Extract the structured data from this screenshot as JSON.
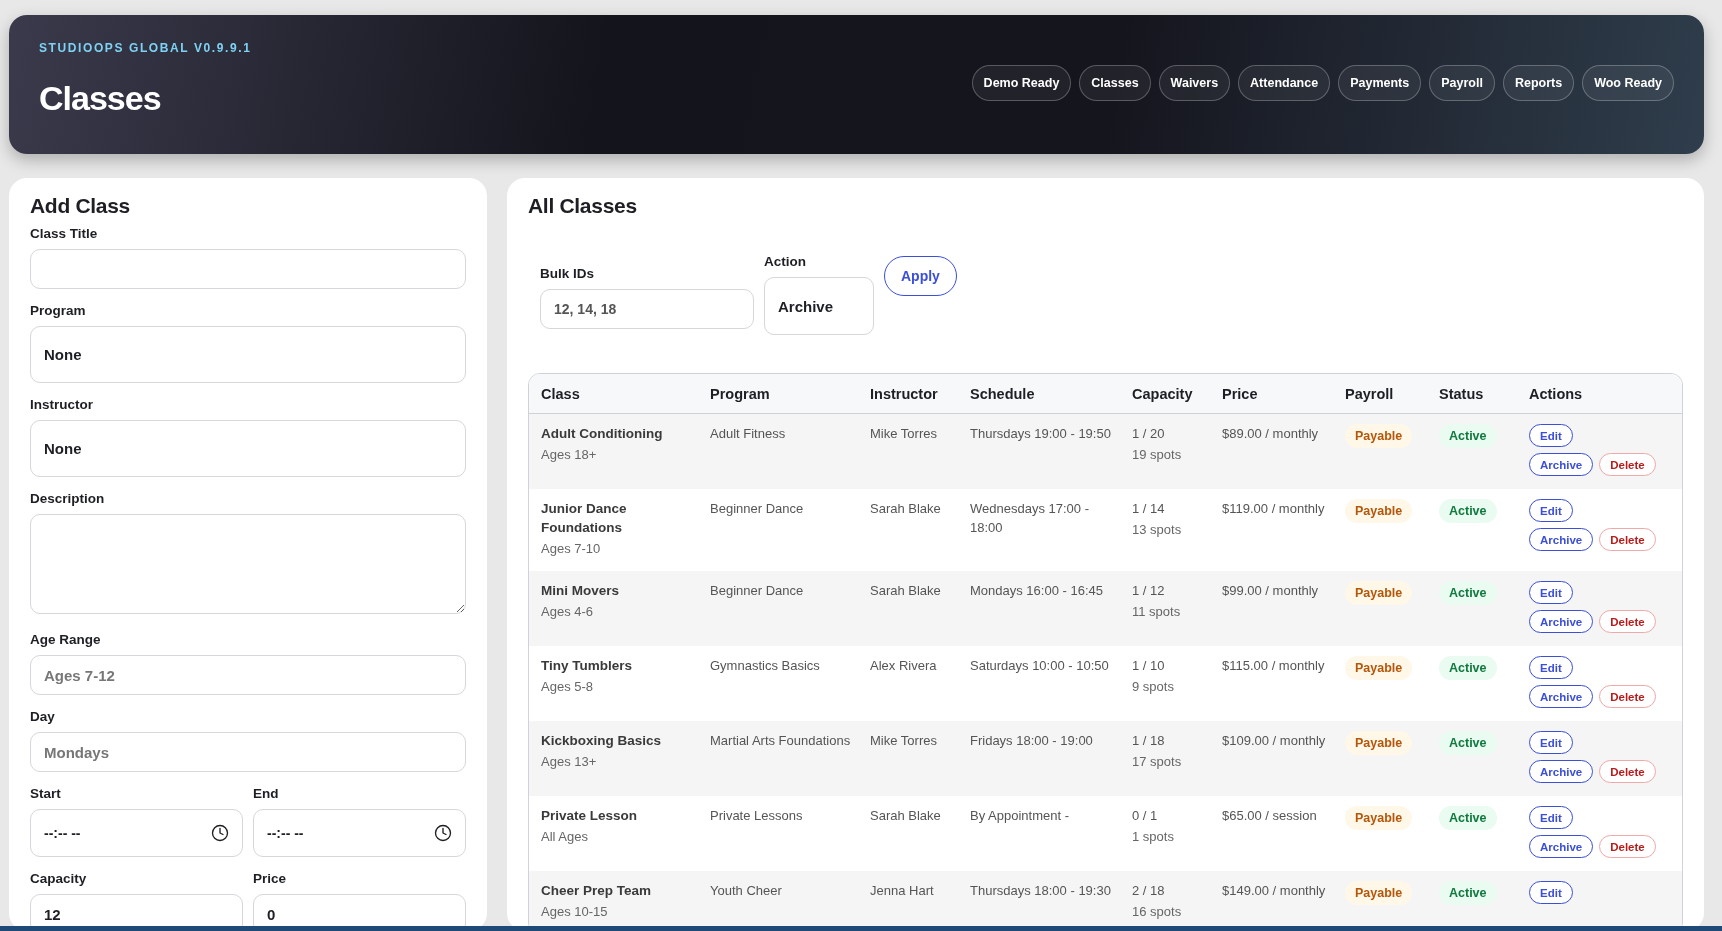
{
  "header": {
    "brand": "STUDIOOPS GLOBAL V0.9.9.1",
    "title": "Classes",
    "nav": [
      {
        "label": "Demo Ready"
      },
      {
        "label": "Classes"
      },
      {
        "label": "Waivers"
      },
      {
        "label": "Attendance"
      },
      {
        "label": "Payments"
      },
      {
        "label": "Payroll"
      },
      {
        "label": "Reports"
      },
      {
        "label": "Woo Ready"
      }
    ]
  },
  "form": {
    "title": "Add Class",
    "rows": [
      [
        {
          "label": "Class Title",
          "kind": "text"
        }
      ],
      [
        {
          "label": "Program",
          "kind": "select",
          "value": "None"
        }
      ],
      [
        {
          "label": "Instructor",
          "kind": "select",
          "value": "None"
        }
      ],
      [
        {
          "label": "Description",
          "kind": "textarea"
        }
      ],
      [
        {
          "label": "Age Range",
          "kind": "text",
          "placeholder": "Ages 7-12"
        }
      ],
      [
        {
          "label": "Day",
          "kind": "text",
          "placeholder": "Mondays"
        }
      ],
      [
        {
          "label": "Start",
          "kind": "time",
          "placeholder": "--:-- --"
        },
        {
          "label": "End",
          "kind": "time",
          "placeholder": "--:-- --"
        }
      ],
      [
        {
          "label": "Capacity",
          "kind": "text",
          "value": "12"
        },
        {
          "label": "Price",
          "kind": "text",
          "value": "0"
        }
      ]
    ]
  },
  "classes": {
    "title": "All Classes",
    "bulk_ids": {
      "label": "Bulk IDs",
      "placeholder": "12, 14, 18"
    },
    "action": {
      "label": "Action",
      "value": "Archive"
    },
    "apply": "Apply",
    "columns": [
      "Class",
      "Program",
      "Instructor",
      "Schedule",
      "Capacity",
      "Price",
      "Payroll",
      "Status",
      "Actions"
    ],
    "rows": [
      {
        "name": "Adult Conditioning",
        "ages": "Ages 18+",
        "program": "Adult Fitness",
        "instructor": "Mike Torres",
        "schedule": "Thursdays 19:00 - 19:50",
        "capacity": "1 / 20",
        "spots": "19 spots",
        "price": "$89.00 / monthly",
        "payroll": "Payable",
        "status": "Active",
        "actions": [
          [
            {
              "label": "Edit",
              "kind": "primary"
            }
          ],
          [
            {
              "label": "Archive",
              "kind": "primary"
            },
            {
              "label": "Delete",
              "kind": "danger"
            }
          ]
        ]
      },
      {
        "name": "Junior Dance Foundations",
        "ages": "Ages 7-10",
        "program": "Beginner Dance",
        "instructor": "Sarah Blake",
        "schedule": "Wednesdays 17:00 - 18:00",
        "capacity": "1 / 14",
        "spots": "13 spots",
        "price": "$119.00 / monthly",
        "payroll": "Payable",
        "status": "Active",
        "actions": [
          [
            {
              "label": "Edit",
              "kind": "primary"
            }
          ],
          [
            {
              "label": "Archive",
              "kind": "primary"
            },
            {
              "label": "Delete",
              "kind": "danger"
            }
          ]
        ]
      },
      {
        "name": "Mini Movers",
        "ages": "Ages 4-6",
        "program": "Beginner Dance",
        "instructor": "Sarah Blake",
        "schedule": "Mondays 16:00 - 16:45",
        "capacity": "1 / 12",
        "spots": "11 spots",
        "price": "$99.00 / monthly",
        "payroll": "Payable",
        "status": "Active",
        "actions": [
          [
            {
              "label": "Edit",
              "kind": "primary"
            }
          ],
          [
            {
              "label": "Archive",
              "kind": "primary"
            },
            {
              "label": "Delete",
              "kind": "danger"
            }
          ]
        ]
      },
      {
        "name": "Tiny Tumblers",
        "ages": "Ages 5-8",
        "program": "Gymnastics Basics",
        "instructor": "Alex Rivera",
        "schedule": "Saturdays 10:00 - 10:50",
        "capacity": "1 / 10",
        "spots": "9 spots",
        "price": "$115.00 / monthly",
        "payroll": "Payable",
        "status": "Active",
        "actions": [
          [
            {
              "label": "Edit",
              "kind": "primary"
            }
          ],
          [
            {
              "label": "Archive",
              "kind": "primary"
            },
            {
              "label": "Delete",
              "kind": "danger"
            }
          ]
        ]
      },
      {
        "name": "Kickboxing Basics",
        "ages": "Ages 13+",
        "program": "Martial Arts Foundations",
        "instructor": "Mike Torres",
        "schedule": "Fridays 18:00 - 19:00",
        "capacity": "1 / 18",
        "spots": "17 spots",
        "price": "$109.00 / monthly",
        "payroll": "Payable",
        "status": "Active",
        "actions": [
          [
            {
              "label": "Edit",
              "kind": "primary"
            }
          ],
          [
            {
              "label": "Archive",
              "kind": "primary"
            },
            {
              "label": "Delete",
              "kind": "danger"
            }
          ]
        ]
      },
      {
        "name": "Private Lesson",
        "ages": "All Ages",
        "program": "Private Lessons",
        "instructor": "Sarah Blake",
        "schedule": "By Appointment -",
        "capacity": "0 / 1",
        "spots": "1 spots",
        "price": "$65.00 / session",
        "payroll": "Payable",
        "status": "Active",
        "actions": [
          [
            {
              "label": "Edit",
              "kind": "primary"
            }
          ],
          [
            {
              "label": "Archive",
              "kind": "primary"
            },
            {
              "label": "Delete",
              "kind": "danger"
            }
          ]
        ]
      },
      {
        "name": "Cheer Prep Team",
        "ages": "Ages 10-15",
        "program": "Youth Cheer",
        "instructor": "Jenna Hart",
        "schedule": "Thursdays 18:00 - 19:30",
        "capacity": "2 / 18",
        "spots": "16 spots",
        "price": "$149.00 / monthly",
        "payroll": "Payable",
        "status": "Active",
        "actions": [
          [
            {
              "label": "Edit",
              "kind": "primary"
            }
          ]
        ]
      }
    ]
  }
}
